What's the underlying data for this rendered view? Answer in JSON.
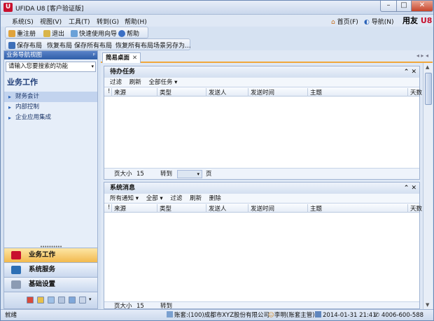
{
  "window": {
    "title": "UFIDA U8 [客户验证版]",
    "logo": "U8",
    "min": "–",
    "max": "□",
    "close": "✕"
  },
  "menu": [
    "系统(S)",
    "视图(V)",
    "工具(T)",
    "转到(G)",
    "帮助(H)"
  ],
  "header_links": {
    "home": "首页(F)",
    "nav": "导航(N)",
    "brand": "用友",
    "brand_mark": "U8"
  },
  "toolbar1": [
    "重注册",
    "退出",
    "快速使用向导",
    "帮助"
  ],
  "toolbar2": [
    "保存布局",
    "恢复布局",
    "保存所有布局",
    "恢复所有布局",
    "场景另存为..."
  ],
  "nav": {
    "header": "业务导航视图",
    "pin": "ᵖ",
    "search_placeholder": "请输入您要搜索的功能",
    "section_title": "业务工作",
    "items": [
      "财务会计",
      "内部控制",
      "企业应用集成"
    ],
    "splitter": "••••••••••",
    "big_buttons": [
      "业务工作",
      "系统服务",
      "基础设置"
    ]
  },
  "tabs": {
    "home": "简易桌面",
    "close": "✕",
    "nav_arrows": "◂ ▸ ◂"
  },
  "todo": {
    "title": "待办任务",
    "controls": "⌃ ✕",
    "tools": [
      "过滤",
      "刷新",
      "全部任务 ▾"
    ],
    "columns": [
      "!",
      "来源",
      "类型",
      "发送人",
      "发送时间",
      "主题",
      "天数"
    ],
    "pager": {
      "label": "页大小",
      "size": "15",
      "goto": "转到",
      "page": "页"
    }
  },
  "messages": {
    "title": "系统消息",
    "controls": "⌃ ✕",
    "tools": [
      "所有通知 ▾",
      "全部 ▾",
      "过滤",
      "刷新",
      "删除"
    ],
    "columns": [
      "!",
      "来源",
      "类型",
      "发送人",
      "发送时间",
      "主题",
      "天数"
    ],
    "pager": {
      "label": "页大小",
      "size": "15",
      "goto": "转到"
    }
  },
  "status": {
    "ready": "就绪",
    "account": "账套:(100)成都市XYZ股份有限公司",
    "user": "李明(账套主管)",
    "datetime": "2014-01-31 21:41",
    "phone": "4006-600-588"
  }
}
